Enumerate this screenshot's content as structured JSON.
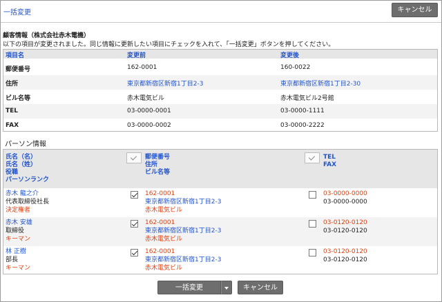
{
  "header": {
    "title": "一括変更",
    "cancel_label": "キャンセル"
  },
  "customer": {
    "heading": "顧客情報（株式会社赤木電機）",
    "instruction": "以下の項目が変更されました。同じ情報に更新したい項目にチェックを入れて、「一括変更」ボタンを押してください。",
    "columns": [
      "項目名",
      "変更前",
      "変更後"
    ],
    "rows": [
      {
        "field": "郵便番号",
        "before": "162-0001",
        "after": "160-0022"
      },
      {
        "field": "住所",
        "before": "東京都新宿区新宿1丁目2-3",
        "after": "東京都新宿区新宿1丁目2-30"
      },
      {
        "field": "ビル名等",
        "before": "赤木電気ビル",
        "after": "赤木電気ビル2号館"
      },
      {
        "field": "TEL",
        "before": "03-0000-0001",
        "after": "03-0000-1111"
      },
      {
        "field": "FAX",
        "before": "03-0000-0002",
        "after": "03-0000-2222"
      }
    ]
  },
  "persons": {
    "heading": "パーソン情報",
    "col1": [
      "氏名（名）",
      "氏名（姓）",
      "役職",
      "パーソンランク"
    ],
    "col2": [
      "郵便番号",
      "住所",
      "ビル名等"
    ],
    "col3": [
      "TEL",
      "FAX"
    ],
    "rows": [
      {
        "name": "赤木 龍之介",
        "title": "代表取締役社長",
        "rank": "決定権者",
        "addr_checked": true,
        "zip": "162-0001",
        "address": "東京都新宿区新宿1丁目2-3",
        "building": "赤木電気ビル",
        "tel_checked": false,
        "tel": "03-0000-0000",
        "fax": "03-0000-0000"
      },
      {
        "name": "赤木 安雄",
        "title": "取締役",
        "rank": "キーマン",
        "addr_checked": true,
        "zip": "162-0001",
        "address": "東京都新宿区新宿1丁目2-3",
        "building": "赤木電気ビル",
        "tel_checked": false,
        "tel": "03-0120-0120",
        "fax": "03-0120-0120"
      },
      {
        "name": "林 正樹",
        "title": "部長",
        "rank": "キーマン",
        "addr_checked": true,
        "zip": "162-0001",
        "address": "東京都新宿区新宿1丁目2-3",
        "building": "赤木電気ビル",
        "tel_checked": false,
        "tel": "03-0120-0120",
        "fax": "03-0120-0120"
      }
    ]
  },
  "footer": {
    "bulk_label": "一括変更",
    "cancel_label": "キャンセル"
  }
}
